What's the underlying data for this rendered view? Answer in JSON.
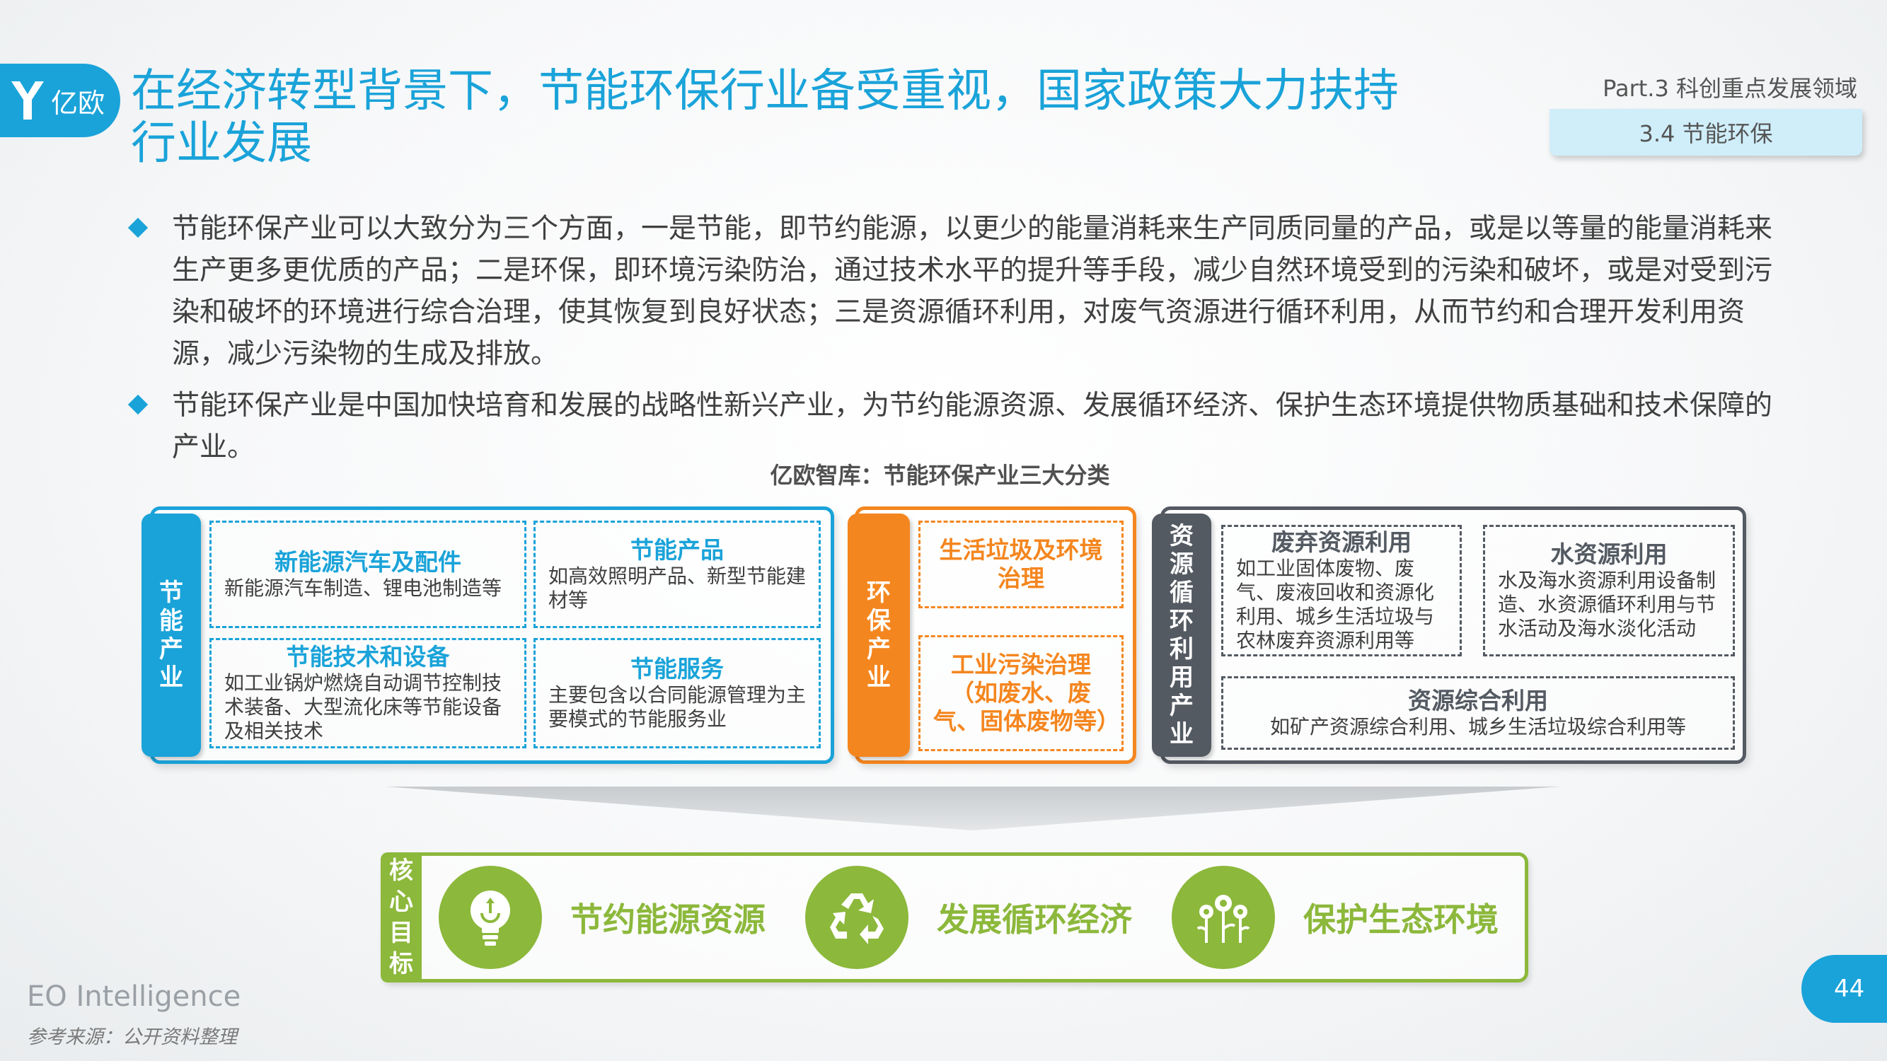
{
  "header": {
    "logo_text": "亿欧",
    "title": "在经济转型背景下，节能环保行业备受重视，国家政策大力扶持行业发展",
    "part": "Part.3 科创重点发展领域",
    "section": "3.4 节能环保"
  },
  "bullets": [
    "节能环保产业可以大致分为三个方面，一是节能，即节约能源，以更少的能量消耗来生产同质同量的产品，或是以等量的能量消耗来生产更多更优质的产品；二是环保，即环境污染防治，通过技术水平的提升等手段，减少自然环境受到的污染和破坏，或是对受到污染和破坏的环境进行综合治理，使其恢复到良好状态；三是资源循环利用，对废气资源进行循环利用，从而节约和合理开发利用资源，减少污染物的生成及排放。",
    "节能环保产业是中国加快培育和发展的战略性新兴产业，为节约能源资源、发展循环经济、保护生态环境提供物质基础和技术保障的产业。"
  ],
  "diagram": {
    "title": "亿欧智库：节能环保产业三大分类",
    "groups": {
      "energy": {
        "label": "节能产业",
        "color": "#1aa3d9",
        "items": [
          {
            "title": "新能源汽车及配件",
            "desc": "新能源汽车制造、锂电池制造等"
          },
          {
            "title": "节能产品",
            "desc": "如高效照明产品、新型节能建材等"
          },
          {
            "title": "节能技术和设备",
            "desc": "如工业锅炉燃烧自动调节控制技术装备、大型流化床等节能设备及相关技术"
          },
          {
            "title": "节能服务",
            "desc": "主要包含以合同能源管理为主要模式的节能服务业"
          }
        ]
      },
      "env": {
        "label": "环保产业",
        "color": "#f4861f",
        "items": [
          {
            "title": "生活垃圾及环境治理"
          },
          {
            "title": "工业污染治理（如废水、废气、固体废物等）"
          }
        ]
      },
      "resource": {
        "label": "资源循环利用产业",
        "color": "#545a62",
        "items": [
          {
            "title": "废弃资源利用",
            "desc": "如工业固体废物、废气、废液回收和资源化利用、城乡生活垃圾与农林废弃资源利用等"
          },
          {
            "title": "水资源利用",
            "desc": "水及海水资源利用设备制造、水资源循环利用与节水活动及海水淡化活动"
          },
          {
            "title": "资源综合利用",
            "desc": "如矿产资源综合利用、城乡生活垃圾综合利用等"
          }
        ]
      }
    },
    "goals": {
      "label": "核心目标",
      "color": "#8cb83b",
      "items": [
        {
          "icon": "lightbulb-icon",
          "label": "节约能源资源"
        },
        {
          "icon": "recycle-icon",
          "label": "发展循环经济"
        },
        {
          "icon": "flowers-icon",
          "label": "保护生态环境"
        }
      ]
    }
  },
  "footer": {
    "brand": "EO Intelligence",
    "source": "参考来源：公开资料整理",
    "page": "44"
  }
}
